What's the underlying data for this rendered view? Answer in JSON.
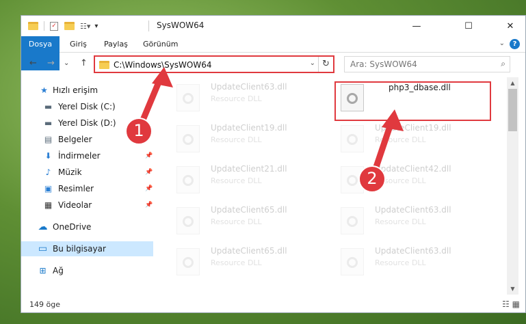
{
  "window": {
    "title": "SysWOW64",
    "minimize_glyph": "—",
    "maximize_glyph": "☐",
    "close_glyph": "✕"
  },
  "ribbon": {
    "tabs": [
      "Dosya",
      "Giriş",
      "Paylaş",
      "Görünüm"
    ],
    "help_glyph": "?"
  },
  "address": {
    "path": "C:\\Windows\\SysWOW64",
    "dropdown_glyph": "⌄",
    "refresh_glyph": "↻"
  },
  "nav_buttons": {
    "back": "←",
    "forward": "→",
    "recent": "⌄",
    "up": "↑"
  },
  "search": {
    "placeholder": "Ara: SysWOW64",
    "icon_glyph": "⌕"
  },
  "sidebar": {
    "items": [
      {
        "label": "Hızlı erişim",
        "icon": "star-icon",
        "glyph": "★",
        "color": "#2b7fd4"
      },
      {
        "label": "Yerel Disk (C:)",
        "icon": "drive-icon",
        "glyph": "▬",
        "color": "#5a6b7a"
      },
      {
        "label": "Yerel Disk (D:)",
        "icon": "drive-icon",
        "glyph": "▬",
        "color": "#5a6b7a"
      },
      {
        "label": "Belgeler",
        "icon": "documents-icon",
        "glyph": "▤",
        "color": "#5a6b7a"
      },
      {
        "label": "İndirmeler",
        "icon": "download-icon",
        "glyph": "⬇",
        "color": "#2b7fd4"
      },
      {
        "label": "Müzik",
        "icon": "music-icon",
        "glyph": "♪",
        "color": "#2b7fd4"
      },
      {
        "label": "Resimler",
        "icon": "pictures-icon",
        "glyph": "▣",
        "color": "#2b7fd4"
      },
      {
        "label": "Videolar",
        "icon": "video-icon",
        "glyph": "▦",
        "color": "#333333"
      },
      {
        "label": "OneDrive",
        "icon": "cloud-icon",
        "glyph": "☁",
        "color": "#1979ca"
      },
      {
        "label": "Bu bilgisayar",
        "icon": "computer-icon",
        "glyph": "▭",
        "color": "#1979ca"
      },
      {
        "label": "Ağ",
        "icon": "network-icon",
        "glyph": "⊞",
        "color": "#1979ca"
      }
    ],
    "pin_glyph": "📌"
  },
  "files": {
    "left": [
      {
        "name": "UpdateClient63.dll",
        "type": "Resource DLL"
      },
      {
        "name": "UpdateClient19.dll",
        "type": "Resource DLL"
      },
      {
        "name": "UpdateClient21.dll",
        "type": "Resource DLL"
      },
      {
        "name": "UpdateClient65.dll",
        "type": "Resource DLL"
      },
      {
        "name": "UpdateClient65.dll",
        "type": "Resource DLL"
      }
    ],
    "right": [
      {
        "name": "php3_dbase.dll",
        "type": ""
      },
      {
        "name": "UpdateClient19.dll",
        "type": "Resource DLL"
      },
      {
        "name": "UpdateClient42.dll",
        "type": "Resource DLL"
      },
      {
        "name": "UpdateClient63.dll",
        "type": "Resource DLL"
      },
      {
        "name": "UpdateClient63.dll",
        "type": "Resource DLL"
      }
    ]
  },
  "status": {
    "count": "149 öge",
    "views_glyph": "☷ ▦"
  },
  "annotations": {
    "step1": "1",
    "step2": "2",
    "color": "#e0393e"
  }
}
